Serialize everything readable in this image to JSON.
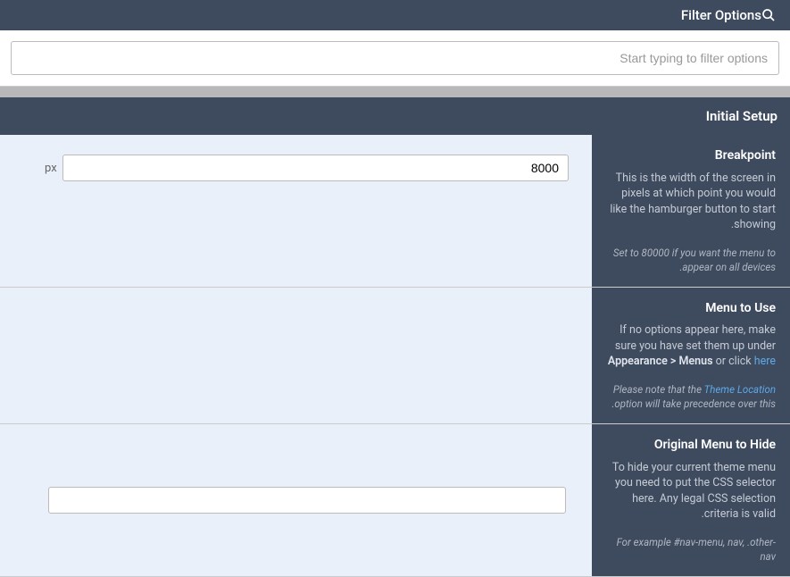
{
  "header": {
    "title": "Filter Options"
  },
  "filter": {
    "placeholder": "Start typing to filter options"
  },
  "section": {
    "title": "Initial Setup"
  },
  "options": {
    "breakpoint": {
      "title": "Breakpoint",
      "desc": "This is the width of the screen in pixels at which point you would like the hamburger button to start showing.",
      "note": "Set to 80000 if you want the menu to appear on all devices.",
      "value": "8000",
      "suffix": "px"
    },
    "menuToUse": {
      "title": "Menu to Use",
      "desc_pre": "If no options appear here, make sure you have set them up under ",
      "desc_strong": "Appearance > Menus",
      "desc_mid": " or click ",
      "desc_link": "here",
      "note_pre": "Please note that the ",
      "note_link": "Theme Location",
      "note_post": " option will take precedence over this."
    },
    "originalMenu": {
      "title": "Original Menu to Hide",
      "desc": "To hide your current theme menu you need to put the CSS selector here. Any legal CSS selection criteria is valid.",
      "note": "For example #nav-menu, nav, .other-nav",
      "value": ""
    }
  }
}
